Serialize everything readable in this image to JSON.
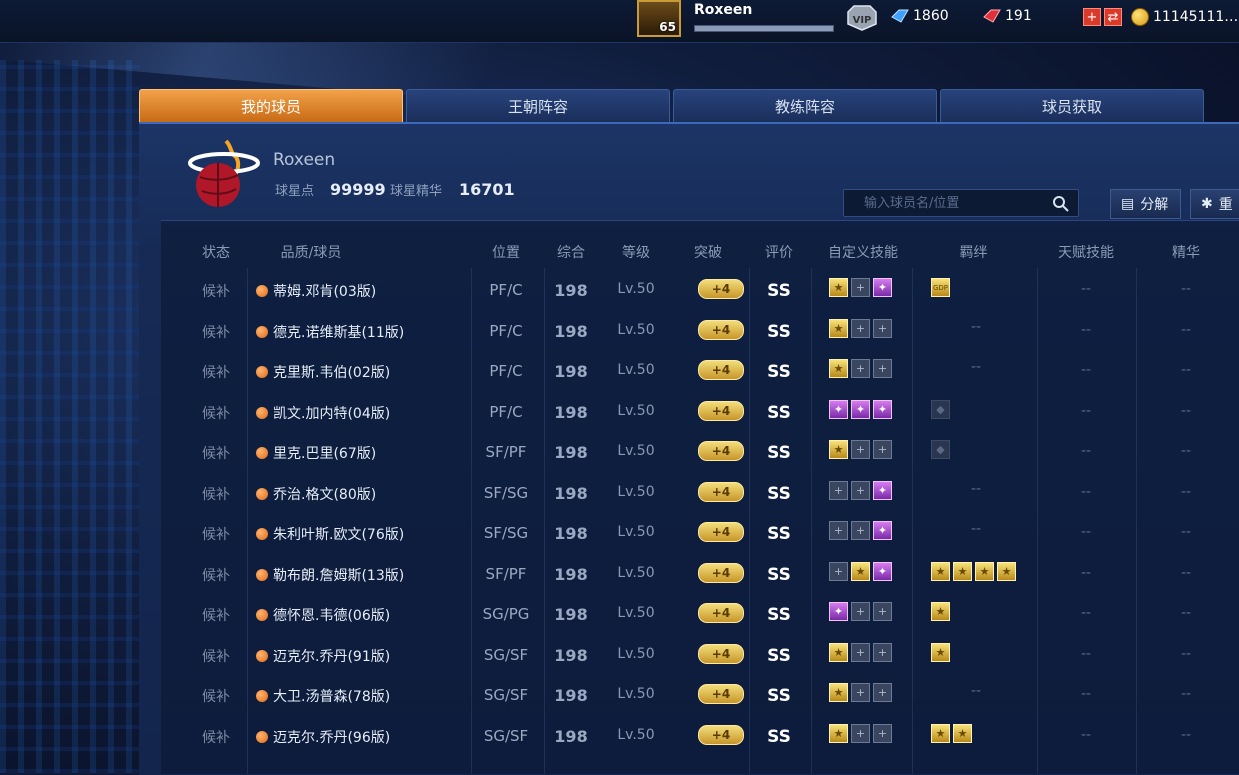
{
  "topbar": {
    "player_level": "65",
    "player_name": "Roxeen",
    "exp_fraction": 1.0,
    "vip_label": "VIP",
    "diamonds": "1860",
    "tickets": "191",
    "gold": "11145111…"
  },
  "tabs": [
    {
      "label": "我的球员",
      "active": true
    },
    {
      "label": "王朝阵容",
      "active": false
    },
    {
      "label": "教练阵容",
      "active": false
    },
    {
      "label": "球员获取",
      "active": false
    }
  ],
  "team": {
    "name": "Roxeen",
    "star_points_label": "球星点",
    "star_points": "99999",
    "star_essence_label": "球星精华",
    "star_essence": "16701"
  },
  "search": {
    "placeholder": "输入球员名/位置"
  },
  "actions": {
    "split": "分解",
    "reset": "重"
  },
  "table": {
    "headers": {
      "status": "状态",
      "name": "品质/球员",
      "position": "位置",
      "overall": "综合",
      "level": "等级",
      "breakthrough": "突破",
      "grade": "评价",
      "skills": "自定义技能",
      "bond": "羁绊",
      "talent": "天赋技能",
      "essence": "精华"
    },
    "rows": [
      {
        "status": "候补",
        "name": "蒂姆.邓肯(03版)",
        "position": "PF/C",
        "overall": "198",
        "level": "Lv.50",
        "breakthrough": "+4",
        "grade": "SS",
        "skills": [
          "gold",
          "empty",
          "purple"
        ],
        "bond": [
          "GDP"
        ],
        "talent": "--",
        "essence": "--"
      },
      {
        "status": "候补",
        "name": "德克.诺维斯基(11版)",
        "position": "PF/C",
        "overall": "198",
        "level": "Lv.50",
        "breakthrough": "+4",
        "grade": "SS",
        "skills": [
          "gold",
          "empty",
          "empty"
        ],
        "bond": [],
        "talent": "--",
        "essence": "--"
      },
      {
        "status": "候补",
        "name": "克里斯.韦伯(02版)",
        "position": "PF/C",
        "overall": "198",
        "level": "Lv.50",
        "breakthrough": "+4",
        "grade": "SS",
        "skills": [
          "gold",
          "empty",
          "empty"
        ],
        "bond": [],
        "talent": "--",
        "essence": "--"
      },
      {
        "status": "候补",
        "name": "凯文.加内特(04版)",
        "position": "PF/C",
        "overall": "198",
        "level": "Lv.50",
        "breakthrough": "+4",
        "grade": "SS",
        "skills": [
          "purple",
          "purple",
          "purple"
        ],
        "bond": [
          "faded"
        ],
        "talent": "--",
        "essence": "--"
      },
      {
        "status": "候补",
        "name": "里克.巴里(67版)",
        "position": "SF/PF",
        "overall": "198",
        "level": "Lv.50",
        "breakthrough": "+4",
        "grade": "SS",
        "skills": [
          "gold",
          "empty",
          "empty"
        ],
        "bond": [
          "faded"
        ],
        "talent": "--",
        "essence": "--"
      },
      {
        "status": "候补",
        "name": "乔治.格文(80版)",
        "position": "SF/SG",
        "overall": "198",
        "level": "Lv.50",
        "breakthrough": "+4",
        "grade": "SS",
        "skills": [
          "empty",
          "empty",
          "purple"
        ],
        "bond": [],
        "talent": "--",
        "essence": "--"
      },
      {
        "status": "候补",
        "name": "朱利叶斯.欧文(76版)",
        "position": "SF/SG",
        "overall": "198",
        "level": "Lv.50",
        "breakthrough": "+4",
        "grade": "SS",
        "skills": [
          "empty",
          "empty",
          "purple"
        ],
        "bond": [],
        "talent": "--",
        "essence": "--"
      },
      {
        "status": "候补",
        "name": "勒布朗.詹姆斯(13版)",
        "position": "SF/PF",
        "overall": "198",
        "level": "Lv.50",
        "breakthrough": "+4",
        "grade": "SS",
        "skills": [
          "empty",
          "gold",
          "purple"
        ],
        "bond": [
          "gold",
          "gold",
          "gold",
          "gold"
        ],
        "talent": "--",
        "essence": "--"
      },
      {
        "status": "候补",
        "name": "德怀恩.韦德(06版)",
        "position": "SG/PG",
        "overall": "198",
        "level": "Lv.50",
        "breakthrough": "+4",
        "grade": "SS",
        "skills": [
          "purple",
          "empty",
          "empty"
        ],
        "bond": [
          "gold"
        ],
        "talent": "--",
        "essence": "--"
      },
      {
        "status": "候补",
        "name": "迈克尔.乔丹(91版)",
        "position": "SG/SF",
        "overall": "198",
        "level": "Lv.50",
        "breakthrough": "+4",
        "grade": "SS",
        "skills": [
          "gold",
          "empty",
          "empty"
        ],
        "bond": [
          "gold"
        ],
        "talent": "--",
        "essence": "--"
      },
      {
        "status": "候补",
        "name": "大卫.汤普森(78版)",
        "position": "SG/SF",
        "overall": "198",
        "level": "Lv.50",
        "breakthrough": "+4",
        "grade": "SS",
        "skills": [
          "gold",
          "empty",
          "empty"
        ],
        "bond": [],
        "talent": "--",
        "essence": "--"
      },
      {
        "status": "候补",
        "name": "迈克尔.乔丹(96版)",
        "position": "SG/SF",
        "overall": "198",
        "level": "Lv.50",
        "breakthrough": "+4",
        "grade": "SS",
        "skills": [
          "gold",
          "empty",
          "empty"
        ],
        "bond": [
          "gold",
          "gold"
        ],
        "talent": "--",
        "essence": "--"
      }
    ]
  }
}
